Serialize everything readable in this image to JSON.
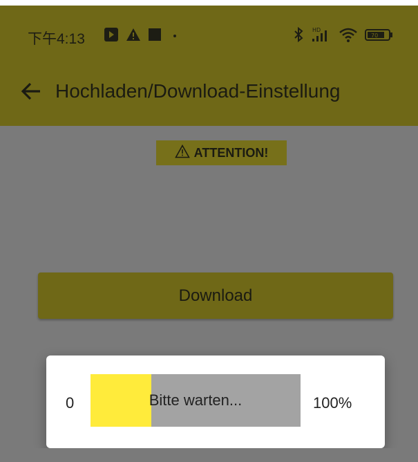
{
  "status_bar": {
    "time": "下午4:13",
    "left_icons": [
      "app-notification-icon",
      "warning-icon",
      "square-icon",
      "dot-icon"
    ],
    "right_icons": [
      "bluetooth-icon",
      "hd-signal-icon",
      "wifi-icon",
      "battery-icon"
    ],
    "battery": "70"
  },
  "app_bar": {
    "title": "Hochladen/Download-Einstellung"
  },
  "main": {
    "attention_label": "ATTENTION!",
    "download_button_label": "Download"
  },
  "progress_dialog": {
    "min_label": "0",
    "max_label": "100%",
    "message": "Bitte warten...",
    "progress": 0.29
  },
  "colors": {
    "appbar_dimmed": "#6f6817",
    "overlay_gray": "#7a7a7a",
    "progress_fill": "#ffeb3b",
    "progress_track": "#a3a3a3"
  }
}
